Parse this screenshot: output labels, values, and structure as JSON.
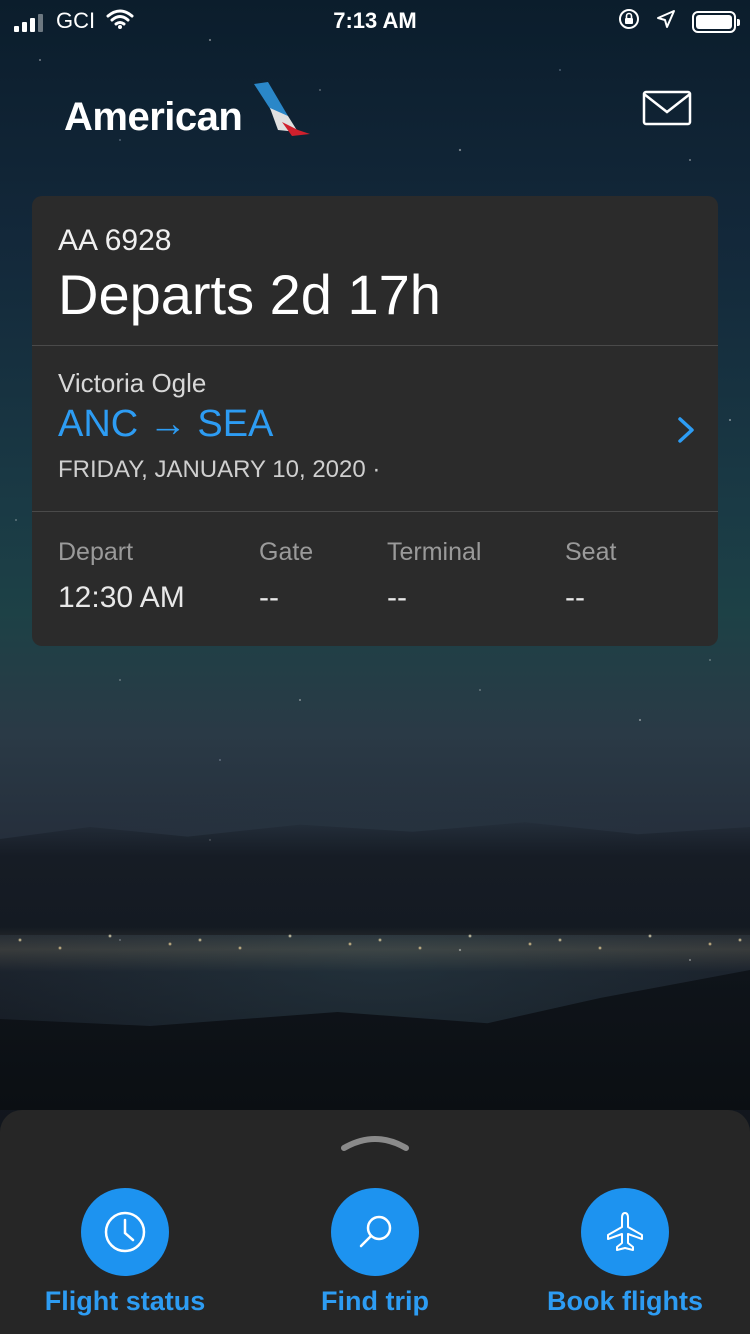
{
  "status_bar": {
    "carrier": "GCI",
    "time": "7:13 AM"
  },
  "header": {
    "brand": "American",
    "brand_logo_icon": "american-flight-symbol",
    "message_icon": "envelope-icon"
  },
  "flight_card": {
    "flight_number": "AA 6928",
    "departs_in": "Departs 2d 17h",
    "passenger": "Victoria Ogle",
    "route": "ANC → SEA",
    "date": "FRIDAY, JANUARY 10, 2020 ·",
    "details": [
      {
        "label": "Depart",
        "value": "12:30 AM"
      },
      {
        "label": "Gate",
        "value": "--"
      },
      {
        "label": "Terminal",
        "value": "--"
      },
      {
        "label": "Seat",
        "value": "--"
      }
    ]
  },
  "bottom_actions": [
    {
      "label": "Flight status",
      "icon": "clock-icon"
    },
    {
      "label": "Find trip",
      "icon": "search-icon"
    },
    {
      "label": "Book flights",
      "icon": "airplane-icon"
    }
  ],
  "colors": {
    "accent_blue": "#2d9cf3",
    "card_bg": "#2b2b2b",
    "sheet_bg": "#262626"
  }
}
